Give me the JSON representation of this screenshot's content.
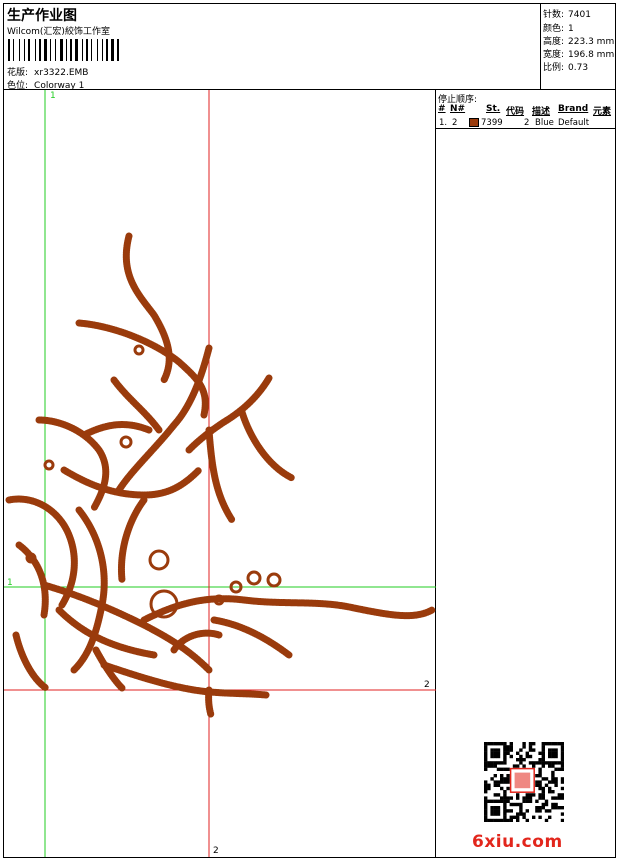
{
  "header": {
    "title": "生产作业图",
    "subtitle": "Wilcom(汇宏)絞饰工作室",
    "file_label": "花版:",
    "file_value": "xr3322.EMB",
    "color_label": "色位:",
    "color_value": "Colorway 1"
  },
  "stats": [
    {
      "label": "针数:",
      "value": "7401"
    },
    {
      "label": "颜色:",
      "value": "1"
    },
    {
      "label": "高度:",
      "value": "223.3 mm"
    },
    {
      "label": "宽度:",
      "value": "196.8 mm"
    },
    {
      "label": "比例:",
      "value": "0.73"
    }
  ],
  "axes": {
    "green_v_label": "1",
    "green_h_label": "1",
    "red_v_label": "2",
    "red_h_label": "2"
  },
  "colors": {
    "thread": "#9a3b0c",
    "green_axis": "#22cc22",
    "red_axis": "#e02020",
    "watermark": "#e2261c"
  },
  "stop_sequence": {
    "title": "停止顺序:",
    "columns": [
      "#",
      "N#",
      "St.",
      "代码",
      "描述",
      "Brand",
      "元素"
    ],
    "rows": [
      {
        "index": "1.",
        "n": "2",
        "code": "7399",
        "stitches": "2",
        "description": "Blue",
        "brand": "Default"
      }
    ]
  },
  "watermark": "6xiu.com",
  "icons": {
    "qr": "qr-code-icon",
    "barcode": "barcode-icon"
  }
}
